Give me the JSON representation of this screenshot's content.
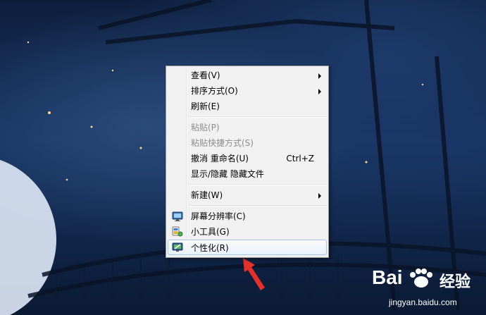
{
  "context_menu": {
    "items": [
      {
        "label": "查看(V)",
        "submenu": true
      },
      {
        "label": "排序方式(O)",
        "submenu": true
      },
      {
        "label": "刷新(E)"
      },
      {
        "label": "粘贴(P)",
        "disabled": true
      },
      {
        "label": "粘贴快捷方式(S)",
        "disabled": true
      },
      {
        "label": "撤消 重命名(U)",
        "shortcut": "Ctrl+Z"
      },
      {
        "label": "显示/隐藏 隐藏文件"
      },
      {
        "label": "新建(W)",
        "submenu": true
      },
      {
        "label": "屏幕分辨率(C)",
        "icon": "monitor-icon"
      },
      {
        "label": "小工具(G)",
        "icon": "gadgets-icon"
      },
      {
        "label": "个性化(R)",
        "icon": "personalize-icon",
        "highlighted": true
      }
    ]
  },
  "watermark": {
    "logo": "Bai",
    "logo_suffix": "经验",
    "url": "jingyan.baidu.com"
  },
  "colors": {
    "menu_bg": "#f1f1f1",
    "highlight_border": "#a8c8eb",
    "arrow_annotation": "#e8302a"
  }
}
